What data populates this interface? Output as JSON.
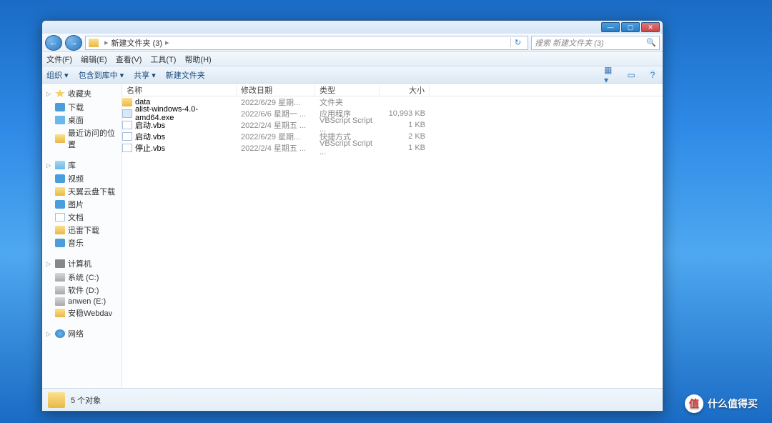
{
  "window_controls": {
    "min": "—",
    "max": "▢",
    "close": "✕"
  },
  "nav": {
    "back": "←",
    "fwd": "→"
  },
  "breadcrumb": {
    "folder": "新建文件夹 (3)",
    "sep": "▸"
  },
  "search": {
    "placeholder": "搜索 新建文件夹 (3)"
  },
  "menu": {
    "file": "文件(F)",
    "edit": "编辑(E)",
    "view": "查看(V)",
    "tools": "工具(T)",
    "help": "帮助(H)"
  },
  "toolbar": {
    "organize": "组织 ▾",
    "include": "包含到库中 ▾",
    "share": "共享 ▾",
    "newfolder": "新建文件夹",
    "views": "▦ ▾"
  },
  "sidebar": {
    "fav": {
      "head": "收藏夹",
      "items": [
        "下载",
        "桌面",
        "最近访问的位置"
      ]
    },
    "lib": {
      "head": "库",
      "items": [
        "视频",
        "天翼云盘下载",
        "图片",
        "文档",
        "迅雷下载",
        "音乐"
      ]
    },
    "comp": {
      "head": "计算机",
      "items": [
        "系统 (C:)",
        "软件 (D:)",
        "anwen (E:)",
        "安稳Webdav"
      ]
    },
    "net": {
      "head": "网络"
    }
  },
  "columns": {
    "name": "名称",
    "date": "修改日期",
    "type": "类型",
    "size": "大小"
  },
  "files": [
    {
      "name": "data",
      "date": "2022/6/29 星期...",
      "type": "文件夹",
      "size": "",
      "ico": "folder"
    },
    {
      "name": "alist-windows-4.0-amd64.exe",
      "date": "2022/6/6 星期一 ...",
      "type": "应用程序",
      "size": "10,993 KB",
      "ico": "exe"
    },
    {
      "name": "启动.vbs",
      "date": "2022/2/4 星期五 ...",
      "type": "VBScript Script ...",
      "size": "1 KB",
      "ico": "doc"
    },
    {
      "name": "启动.vbs",
      "date": "2022/6/29 星期...",
      "type": "快捷方式",
      "size": "2 KB",
      "ico": "doc"
    },
    {
      "name": "停止.vbs",
      "date": "2022/2/4 星期五 ...",
      "type": "VBScript Script ...",
      "size": "1 KB",
      "ico": "doc"
    }
  ],
  "status": {
    "text": "5 个对象"
  },
  "watermark": {
    "badge": "值",
    "text": "什么值得买"
  }
}
